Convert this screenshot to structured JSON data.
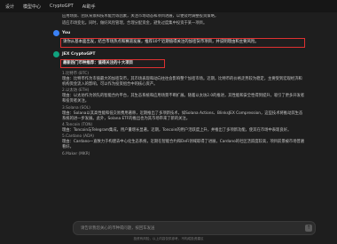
{
  "topbar": {
    "items": [
      "设计",
      "模型中心",
      "CryptoGPT",
      "AI助手"
    ]
  },
  "chat": {
    "intro_lines": [
      "应用场景、团队背景和技术能力等因素，关注市场动态和项目进展，以便及时调整投资策略，",
      "适应市场变化。同时，做好风险管理，合理分配资金，避免过度集中投资于某一项目。"
    ],
    "user": {
      "name": "You",
      "message": "请你从基本面出发，结合市场热点和赛道发展，推荐10个近期值得关注的加密货币项目，并说明理由和主要风险。"
    },
    "bot": {
      "name": "JEX CryptoGPT",
      "heading": "最新热门币种推荐：值得关注的十大项目",
      "items": [
        {
          "title": "1.比特币 (BTC)",
          "body": "理由：比特币作为市值最大的加密货币，其市场表现和动向往往会影响整个加密市场。近期，比特币的价格走势较为稳定，主要受到宏观经济和机构资金流入的影响，可以作为投资组合中的核心资产。"
        },
        {
          "title": "2.以太坊 (ETH)",
          "body": "理由：以太坊作为领先的智能合约平台，其生态系统和应用场景不断扩展。随着以太坊2.0的推进，其性能和安全性得到提升，吸引了更多开发者和投资者关注。"
        },
        {
          "title": "3.Solana (SOL)",
          "body": "理由：Solana以其高性能和低交易费用著称，近期推出了多项新技术，如Solana Actions、BlinksJEX Compression，这些技术将推动其生态系统的进一步发展。此外，Solana ETF的推出也为其市场带来了新的关注。"
        },
        {
          "title": "4.Toncoin (TON)",
          "body": "理由：Toncoin与Telegram集成，用户量增长显著。近期，Toncoin的用户活跃度上升，并推出了多项新功能，使其在市场中表现良好。"
        },
        {
          "title": "5.Cardano (ADA)",
          "body": "理由：Cardano一直致力于构建去中心化生态系统，近期在智能合约和DeFi领域取得了进展，Cardano的社区活跃度较高，项目前景被市场普遍看好。"
        },
        {
          "title": "6.Maker (MKR)",
          "body": ""
        }
      ]
    }
  },
  "input": {
    "placeholder": "请告诉我您关心的币种或问题，按回车发送",
    "send_icon": "arrow-up-icon"
  },
  "footer": {
    "note": "投资有风险，以上内容仅供参考，不构成投资建议"
  }
}
